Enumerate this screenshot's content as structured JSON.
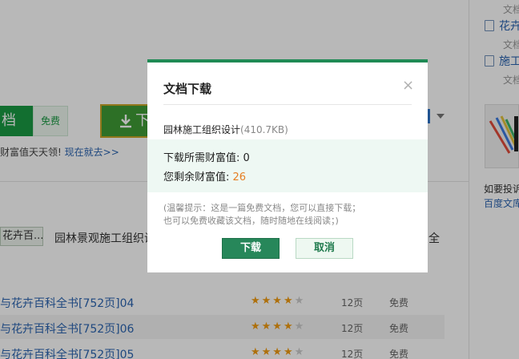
{
  "background": {
    "right_column": {
      "gray_labels": [
        "文档",
        "文档",
        "文档"
      ],
      "links": [
        "花卉",
        "施工"
      ],
      "complaint_text": "如要投诉",
      "library_link": "百度文库"
    },
    "buttons": {
      "doc_label": "档",
      "free_label": "免费",
      "download_label": "下"
    },
    "promo": {
      "text": "财富值天天领! ",
      "link": "现在就去>>"
    },
    "related": {
      "tag": "花卉百...",
      "title": "园林景观施工组织设",
      "tail": "全"
    },
    "list": [
      {
        "name": "与花卉百科全书[752页]04",
        "pages": "12页",
        "price": "免费",
        "stars": 4
      },
      {
        "name": "与花卉百科全书[752页]06",
        "pages": "12页",
        "price": "免费",
        "stars": 4
      },
      {
        "name": "与花卉百科全书[752页]05",
        "pages": "12页",
        "price": "免费",
        "stars": 4
      }
    ]
  },
  "modal": {
    "title": "文档下载",
    "close_glyph": "×",
    "file_name": "园林施工组织设计",
    "file_size": "(410.7KB)",
    "need_label": "下载所需财富值: ",
    "need_value": "0",
    "remain_label": "您剩余财富值: ",
    "remain_value": "26",
    "tip_line1": "(温馨提示：这是一篇免费文档，您可以直接下载；",
    "tip_line2": "也可以免费收藏该文档，随时随地在线阅读；)",
    "download_button": "下载",
    "cancel_button": "取消"
  },
  "colors": {
    "accent_green": "#27875a",
    "value_orange": "#e67e22",
    "link_blue": "#2b65b1"
  }
}
